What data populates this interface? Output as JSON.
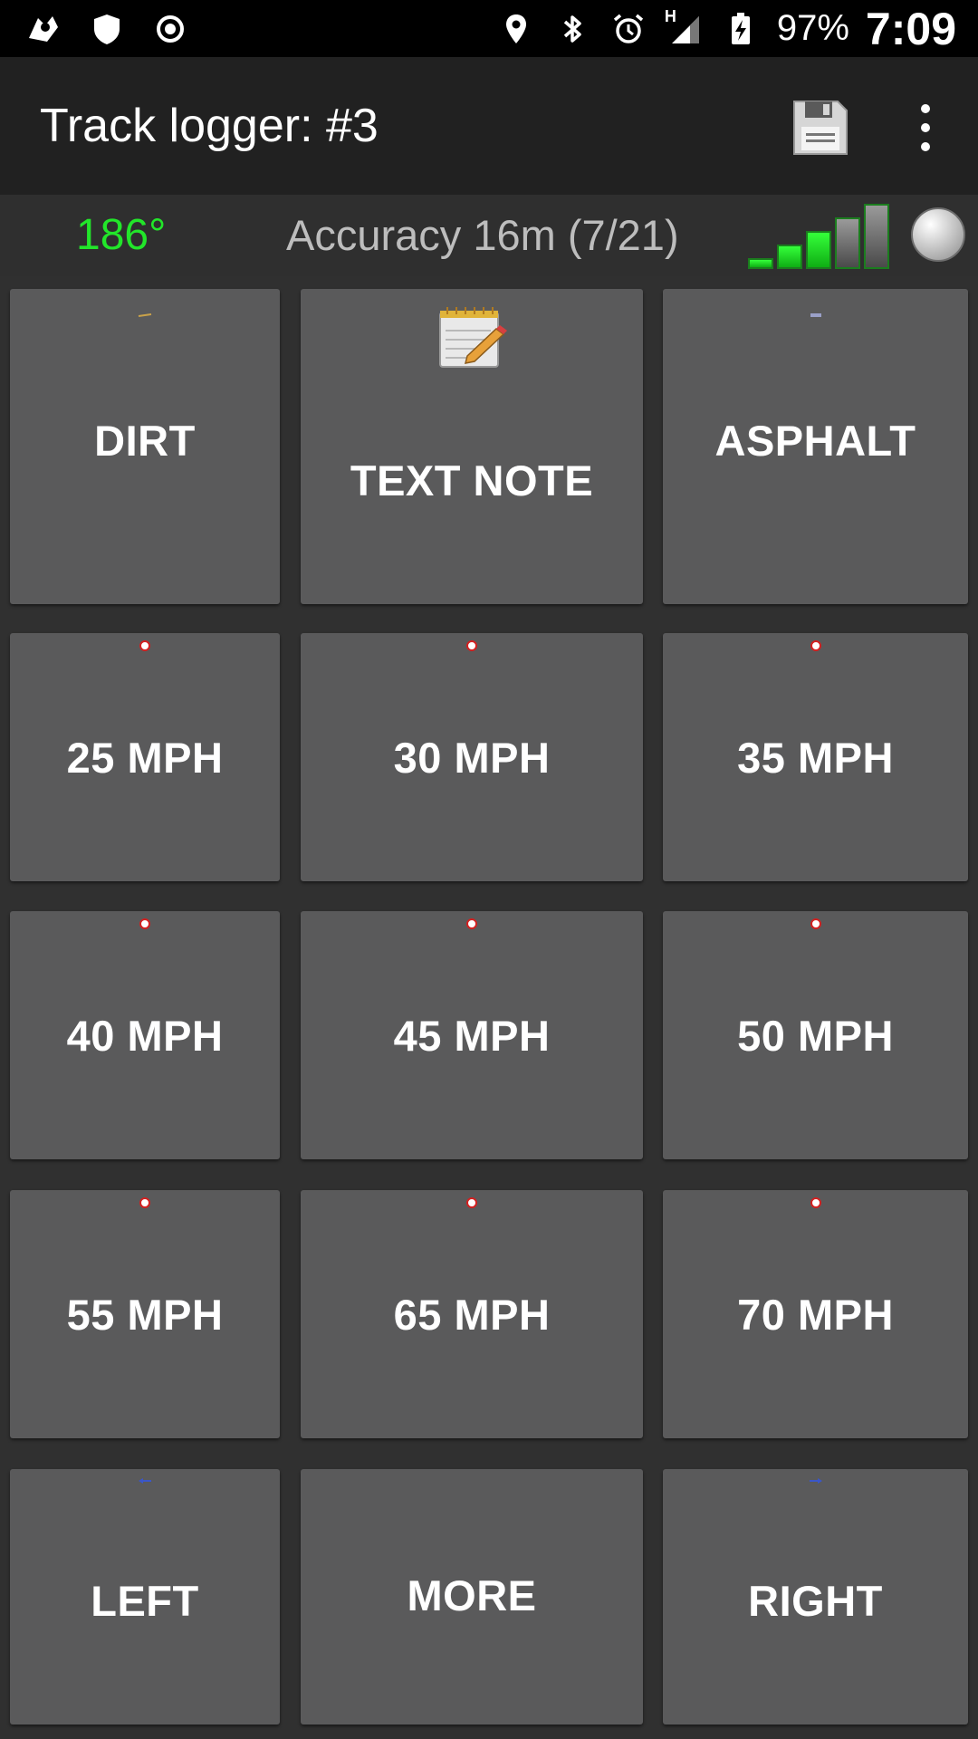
{
  "status_bar": {
    "battery_percent": "97%",
    "time": "7:09",
    "network_type": "H"
  },
  "app_bar": {
    "title": "Track logger: #3"
  },
  "info": {
    "heading": "186°",
    "accuracy": "Accuracy 16m (7/21)",
    "signal_bars_active": 3,
    "signal_bars_total": 5
  },
  "tiles": {
    "dirt": "DIRT",
    "text_note": "TEXT NOTE",
    "asphalt": "ASPHALT",
    "mph25": "25 MPH",
    "mph30": "30 MPH",
    "mph35": "35 MPH",
    "mph40": "40 MPH",
    "mph45": "45 MPH",
    "mph50": "50 MPH",
    "mph55": "55 MPH",
    "mph65": "65 MPH",
    "mph70": "70 MPH",
    "left": "LEFT",
    "more": "MORE",
    "right": "RIGHT"
  },
  "colors": {
    "heading": "#22e62a",
    "tile": "#5a5a5b",
    "background": "#303030"
  }
}
